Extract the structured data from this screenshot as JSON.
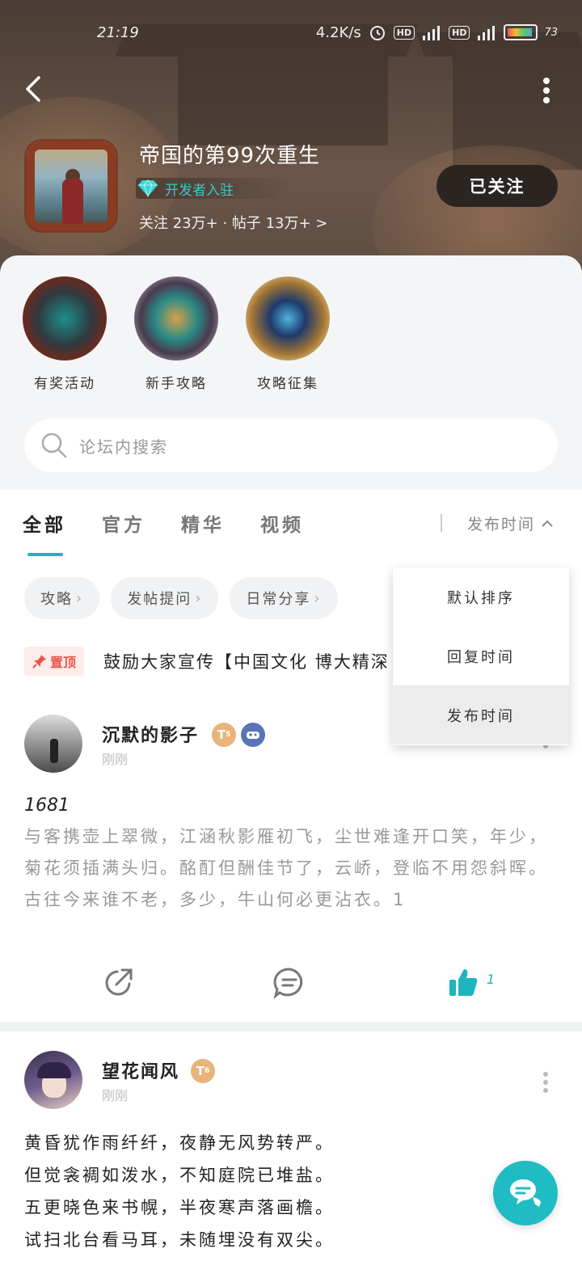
{
  "status_bar": {
    "time": "21:19",
    "net_speed": "4.2K/s",
    "hd1": "HD",
    "hd2": "HD",
    "battery": "73"
  },
  "header": {
    "game_title": "帝国的第99次重生",
    "dev_badge": "开发者入驻",
    "stats": "关注 23万+ · 帖子 13万+ >",
    "follow_label": "已关注"
  },
  "shortcuts": [
    {
      "label": "有奖活动"
    },
    {
      "label": "新手攻略"
    },
    {
      "label": "攻略征集"
    }
  ],
  "search": {
    "placeholder": "论坛内搜索"
  },
  "tabs": [
    {
      "label": "全部"
    },
    {
      "label": "官方"
    },
    {
      "label": "精华"
    },
    {
      "label": "视频"
    }
  ],
  "sort": {
    "current": "发布时间",
    "options": [
      "默认排序",
      "回复时间",
      "发布时间"
    ],
    "selected_index": 2
  },
  "chips": [
    {
      "label": "攻略"
    },
    {
      "label": "发帖提问"
    },
    {
      "label": "日常分享"
    }
  ],
  "pinned": {
    "tag": "置顶",
    "text": "鼓励大家宣传【中国文化 博大精深"
  },
  "posts": [
    {
      "author": "沉默的影子",
      "time": "刚刚",
      "level": "5",
      "number": "1681",
      "body": "与客携壶上翠微，江涵秋影雁初飞，尘世难逢开口笑，年少，菊花须插满头归。酩酊但酬佳节了，云峤，登临不用怨斜晖。古往今来谁不老，多少，牛山何必更沾衣。1",
      "like_count": "1"
    },
    {
      "author": "望花闻风",
      "time": "刚刚",
      "level": "6",
      "lines": [
        "黄昏犹作雨纤纤，夜静无风势转严。",
        "但觉衾裯如泼水，不知庭院已堆盐。",
        "五更晓色来书幌，半夜寒声落画檐。",
        "试扫北台看马耳，未随埋没有双尖。"
      ]
    }
  ],
  "colors": {
    "accent": "#1db5be",
    "pin_red": "#e8554a",
    "banner": "#5b4a3f"
  }
}
